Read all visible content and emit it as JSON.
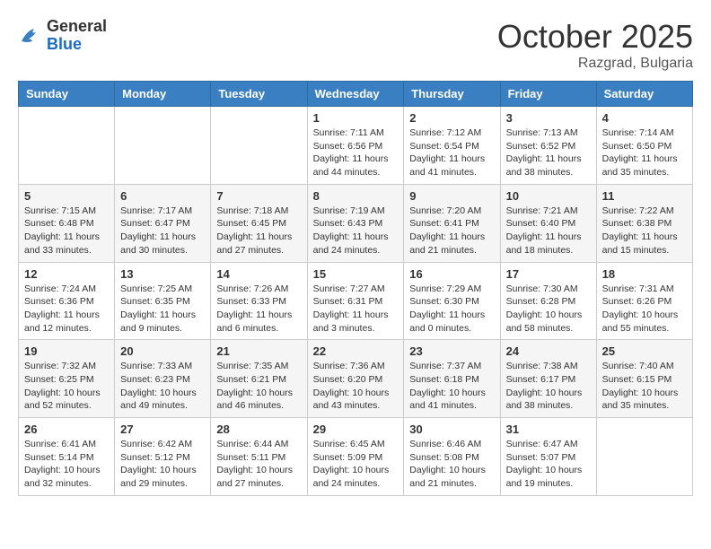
{
  "header": {
    "logo_general": "General",
    "logo_blue": "Blue",
    "month": "October 2025",
    "location": "Razgrad, Bulgaria"
  },
  "weekdays": [
    "Sunday",
    "Monday",
    "Tuesday",
    "Wednesday",
    "Thursday",
    "Friday",
    "Saturday"
  ],
  "weeks": [
    [
      {
        "day": "",
        "info": ""
      },
      {
        "day": "",
        "info": ""
      },
      {
        "day": "",
        "info": ""
      },
      {
        "day": "1",
        "info": "Sunrise: 7:11 AM\nSunset: 6:56 PM\nDaylight: 11 hours and 44 minutes."
      },
      {
        "day": "2",
        "info": "Sunrise: 7:12 AM\nSunset: 6:54 PM\nDaylight: 11 hours and 41 minutes."
      },
      {
        "day": "3",
        "info": "Sunrise: 7:13 AM\nSunset: 6:52 PM\nDaylight: 11 hours and 38 minutes."
      },
      {
        "day": "4",
        "info": "Sunrise: 7:14 AM\nSunset: 6:50 PM\nDaylight: 11 hours and 35 minutes."
      }
    ],
    [
      {
        "day": "5",
        "info": "Sunrise: 7:15 AM\nSunset: 6:48 PM\nDaylight: 11 hours and 33 minutes."
      },
      {
        "day": "6",
        "info": "Sunrise: 7:17 AM\nSunset: 6:47 PM\nDaylight: 11 hours and 30 minutes."
      },
      {
        "day": "7",
        "info": "Sunrise: 7:18 AM\nSunset: 6:45 PM\nDaylight: 11 hours and 27 minutes."
      },
      {
        "day": "8",
        "info": "Sunrise: 7:19 AM\nSunset: 6:43 PM\nDaylight: 11 hours and 24 minutes."
      },
      {
        "day": "9",
        "info": "Sunrise: 7:20 AM\nSunset: 6:41 PM\nDaylight: 11 hours and 21 minutes."
      },
      {
        "day": "10",
        "info": "Sunrise: 7:21 AM\nSunset: 6:40 PM\nDaylight: 11 hours and 18 minutes."
      },
      {
        "day": "11",
        "info": "Sunrise: 7:22 AM\nSunset: 6:38 PM\nDaylight: 11 hours and 15 minutes."
      }
    ],
    [
      {
        "day": "12",
        "info": "Sunrise: 7:24 AM\nSunset: 6:36 PM\nDaylight: 11 hours and 12 minutes."
      },
      {
        "day": "13",
        "info": "Sunrise: 7:25 AM\nSunset: 6:35 PM\nDaylight: 11 hours and 9 minutes."
      },
      {
        "day": "14",
        "info": "Sunrise: 7:26 AM\nSunset: 6:33 PM\nDaylight: 11 hours and 6 minutes."
      },
      {
        "day": "15",
        "info": "Sunrise: 7:27 AM\nSunset: 6:31 PM\nDaylight: 11 hours and 3 minutes."
      },
      {
        "day": "16",
        "info": "Sunrise: 7:29 AM\nSunset: 6:30 PM\nDaylight: 11 hours and 0 minutes."
      },
      {
        "day": "17",
        "info": "Sunrise: 7:30 AM\nSunset: 6:28 PM\nDaylight: 10 hours and 58 minutes."
      },
      {
        "day": "18",
        "info": "Sunrise: 7:31 AM\nSunset: 6:26 PM\nDaylight: 10 hours and 55 minutes."
      }
    ],
    [
      {
        "day": "19",
        "info": "Sunrise: 7:32 AM\nSunset: 6:25 PM\nDaylight: 10 hours and 52 minutes."
      },
      {
        "day": "20",
        "info": "Sunrise: 7:33 AM\nSunset: 6:23 PM\nDaylight: 10 hours and 49 minutes."
      },
      {
        "day": "21",
        "info": "Sunrise: 7:35 AM\nSunset: 6:21 PM\nDaylight: 10 hours and 46 minutes."
      },
      {
        "day": "22",
        "info": "Sunrise: 7:36 AM\nSunset: 6:20 PM\nDaylight: 10 hours and 43 minutes."
      },
      {
        "day": "23",
        "info": "Sunrise: 7:37 AM\nSunset: 6:18 PM\nDaylight: 10 hours and 41 minutes."
      },
      {
        "day": "24",
        "info": "Sunrise: 7:38 AM\nSunset: 6:17 PM\nDaylight: 10 hours and 38 minutes."
      },
      {
        "day": "25",
        "info": "Sunrise: 7:40 AM\nSunset: 6:15 PM\nDaylight: 10 hours and 35 minutes."
      }
    ],
    [
      {
        "day": "26",
        "info": "Sunrise: 6:41 AM\nSunset: 5:14 PM\nDaylight: 10 hours and 32 minutes."
      },
      {
        "day": "27",
        "info": "Sunrise: 6:42 AM\nSunset: 5:12 PM\nDaylight: 10 hours and 29 minutes."
      },
      {
        "day": "28",
        "info": "Sunrise: 6:44 AM\nSunset: 5:11 PM\nDaylight: 10 hours and 27 minutes."
      },
      {
        "day": "29",
        "info": "Sunrise: 6:45 AM\nSunset: 5:09 PM\nDaylight: 10 hours and 24 minutes."
      },
      {
        "day": "30",
        "info": "Sunrise: 6:46 AM\nSunset: 5:08 PM\nDaylight: 10 hours and 21 minutes."
      },
      {
        "day": "31",
        "info": "Sunrise: 6:47 AM\nSunset: 5:07 PM\nDaylight: 10 hours and 19 minutes."
      },
      {
        "day": "",
        "info": ""
      }
    ]
  ]
}
